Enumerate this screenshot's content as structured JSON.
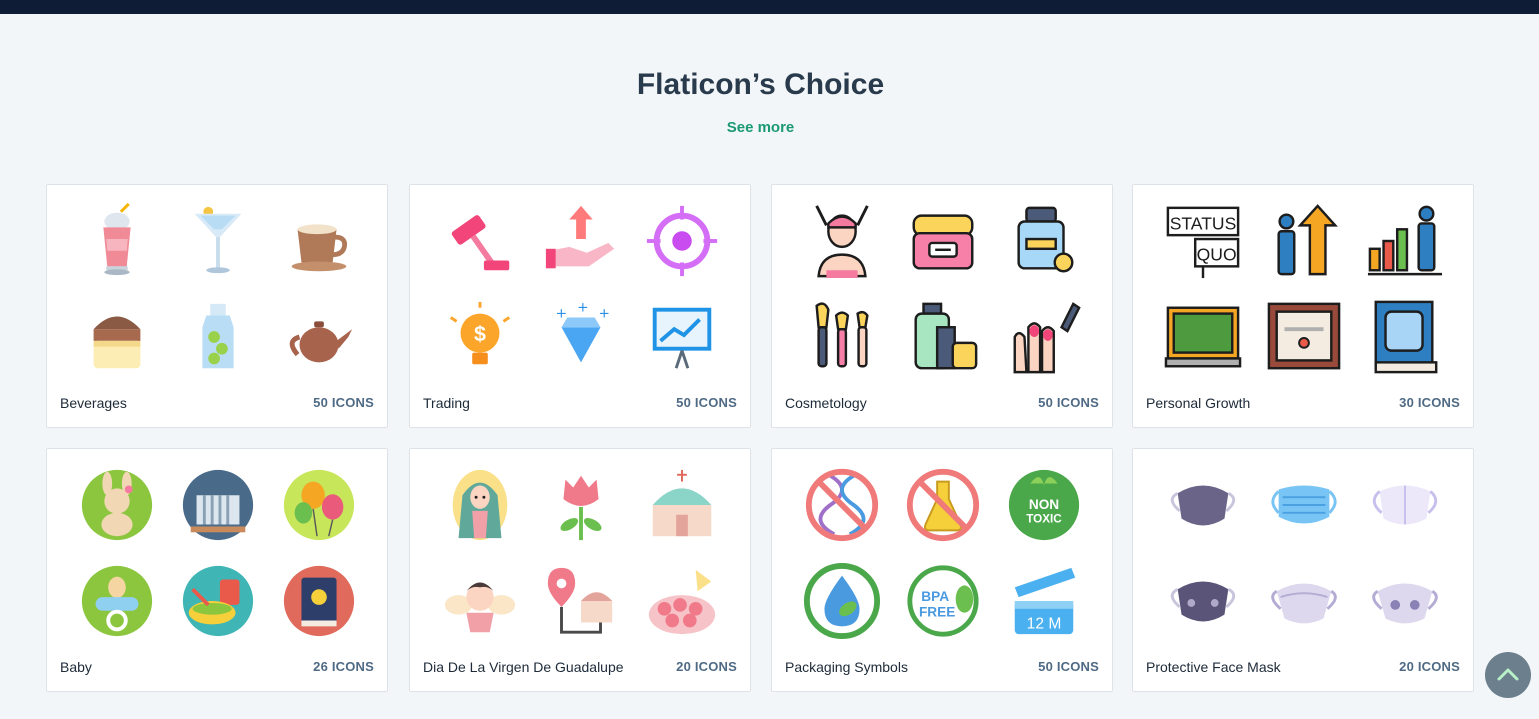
{
  "header": {
    "title": "Flaticon’s Choice",
    "see_more": "See more"
  },
  "scroll_top_icon": "chevron-up-icon",
  "collections": [
    {
      "name": "Beverages",
      "count": "50 ICONS",
      "icons": [
        "milkshake-icon",
        "cocktail-icon",
        "coffee-cup-icon",
        "dessert-cup-icon",
        "lemon-water-bottle-icon",
        "teapot-icon"
      ]
    },
    {
      "name": "Trading",
      "count": "50 ICONS",
      "icons": [
        "gavel-icon",
        "hand-arrow-up-icon",
        "target-icon",
        "idea-dollar-icon",
        "diamond-icon",
        "growth-presentation-icon"
      ]
    },
    {
      "name": "Cosmetology",
      "count": "50 ICONS",
      "icons": [
        "facial-massage-icon",
        "cream-jar-icon",
        "cosmetic-jar-icon",
        "makeup-brushes-icon",
        "skincare-products-icon",
        "nail-polish-icon"
      ]
    },
    {
      "name": "Personal Growth",
      "count": "30 ICONS",
      "icons": [
        "status-quo-sign-icon",
        "person-arrow-up-icon",
        "growth-bar-chart-icon",
        "blackboard-icon",
        "certificate-icon",
        "book-icon"
      ]
    },
    {
      "name": "Baby",
      "count": "26 ICONS",
      "icons": [
        "teddy-bunny-icon",
        "crib-icon",
        "balloons-icon",
        "pacifier-icon",
        "baby-food-icon",
        "storybook-icon"
      ]
    },
    {
      "name": "Dia De La Virgen De Guadalupe",
      "count": "20 ICONS",
      "icons": [
        "virgin-icon",
        "rose-icon",
        "basilica-icon",
        "angel-icon",
        "church-location-icon",
        "roses-icon"
      ]
    },
    {
      "name": "Packaging Symbols",
      "count": "50 ICONS",
      "icons": [
        "no-gmo-icon",
        "no-chemicals-icon",
        "non-toxic-icon",
        "water-resistant-icon",
        "bpa-free-icon",
        "12m-jar-icon"
      ]
    },
    {
      "name": "Protective Face Mask",
      "count": "20 ICONS",
      "icons": [
        "cloth-mask-icon",
        "surgical-mask-icon",
        "n95-mask-icon",
        "filter-mask-icon",
        "respirator-mask-icon",
        "valve-mask-icon"
      ]
    }
  ],
  "icon_labels": {
    "status_top": "STATUS",
    "status_bottom": "QUO",
    "dollar": "$",
    "non": "NON",
    "toxic": "TOXIC",
    "bpa": "BPA",
    "free": "FREE",
    "months": "12 M"
  }
}
